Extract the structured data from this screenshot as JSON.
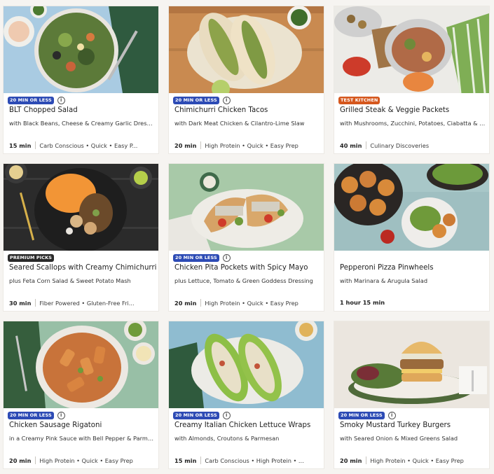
{
  "colors": {
    "badge_blue": "#2d4bb5",
    "badge_orange": "#d5571d",
    "badge_dark": "#2a2a2a"
  },
  "recipes": [
    {
      "badge": "20 MIN OR LESS",
      "badge_color": "#2d4bb5",
      "title": "BLT Chopped Salad",
      "subtitle": "with Black Beans, Cheese & Creamy Garlic Dressing",
      "time": "15 min",
      "tags": "Carb Conscious • Quick • Easy P...",
      "image": "salad-bowl-photo"
    },
    {
      "badge": "20 MIN OR LESS",
      "badge_color": "#2d4bb5",
      "title": "Chimichurri Chicken Tacos",
      "subtitle": "with Dark Meat Chicken & Cilantro-Lime Slaw",
      "time": "20 min",
      "tags": "High Protein • Quick • Easy Prep",
      "image": "tacos-photo"
    },
    {
      "badge": "TEST KITCHEN",
      "badge_color": "#d5571d",
      "title": "Grilled Steak & Veggie Packets",
      "subtitle": "with Mushrooms, Zucchini, Potatoes, Ciabatta & Su...",
      "time": "40 min",
      "tags": "Culinary Discoveries",
      "image": "steak-packets-photo"
    },
    {
      "badge": "PREMIUM PICKS",
      "badge_color": "#2a2a2a",
      "title": "Seared Scallops with Creamy Chimichurri",
      "subtitle": "plus Feta Corn Salad & Sweet Potato Mash",
      "time": "30 min",
      "tags": "Fiber Powered • Gluten-Free Fri...",
      "image": "scallops-photo"
    },
    {
      "badge": "20 MIN OR LESS",
      "badge_color": "#2d4bb5",
      "title": "Chicken Pita Pockets with Spicy Mayo",
      "subtitle": "plus Lettuce, Tomato & Green Goddess Dressing",
      "time": "20 min",
      "tags": "High Protein • Quick • Easy Prep",
      "image": "pita-pockets-photo"
    },
    {
      "badge": "",
      "badge_color": "",
      "title": "Pepperoni Pizza Pinwheels",
      "subtitle": "with Marinara & Arugula Salad",
      "time": "1 hour 15 min",
      "tags": "",
      "image": "pinwheels-photo"
    },
    {
      "badge": "20 MIN OR LESS",
      "badge_color": "#2d4bb5",
      "title": "Chicken Sausage Rigatoni",
      "subtitle": "in a Creamy Pink Sauce with Bell Pepper & Parmesan",
      "time": "20 min",
      "tags": "High Protein • Quick • Easy Prep",
      "image": "rigatoni-photo"
    },
    {
      "badge": "20 MIN OR LESS",
      "badge_color": "#2d4bb5",
      "title": "Creamy Italian Chicken Lettuce Wraps",
      "subtitle": "with Almonds, Croutons & Parmesan",
      "time": "15 min",
      "tags": "Carb Conscious • High Protein • ...",
      "image": "lettuce-wraps-photo"
    },
    {
      "badge": "20 MIN OR LESS",
      "badge_color": "#2d4bb5",
      "title": "Smoky Mustard Turkey Burgers",
      "subtitle": "with Seared Onion & Mixed Greens Salad",
      "time": "20 min",
      "tags": "High Protein • Quick • Easy Prep",
      "image": "burger-photo"
    }
  ]
}
